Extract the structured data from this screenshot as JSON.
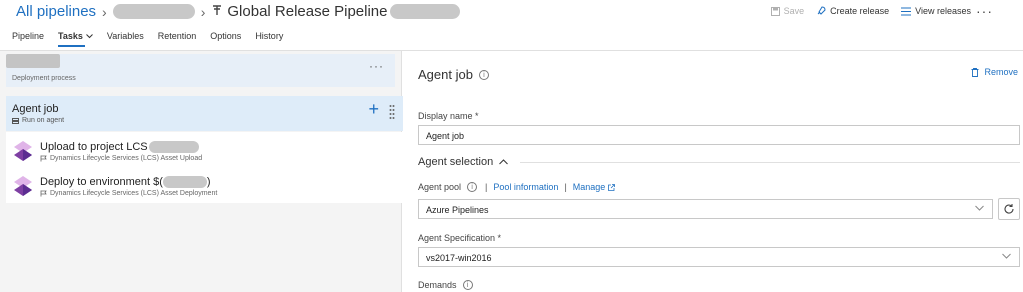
{
  "header": {
    "breadcrumb_root": "All pipelines",
    "pipeline_title": "Global Release Pipeline",
    "actions": {
      "save": "Save",
      "create_release": "Create release",
      "view_releases": "View releases",
      "more": "···"
    }
  },
  "tabs": [
    {
      "label": "Pipeline"
    },
    {
      "label": "Tasks"
    },
    {
      "label": "Variables"
    },
    {
      "label": "Retention"
    },
    {
      "label": "Options"
    },
    {
      "label": "History"
    }
  ],
  "left": {
    "stage": {
      "subtitle": "Deployment process",
      "more": "···"
    },
    "job": {
      "name": "Agent job",
      "subtitle": "Run on agent",
      "add": "+"
    },
    "tasks": [
      {
        "name": "Upload to project LCS",
        "subtitle": "Dynamics Lifecycle Services (LCS) Asset Upload"
      },
      {
        "name": "Deploy to environment $(",
        "name_suffix": ")",
        "subtitle": "Dynamics Lifecycle Services (LCS) Asset Deployment"
      }
    ]
  },
  "right": {
    "title": "Agent job",
    "remove": "Remove",
    "display_name_label": "Display name *",
    "display_name_value": "Agent job",
    "agent_selection": "Agent selection",
    "agent_pool_label": "Agent pool",
    "pool_information": "Pool information",
    "manage": "Manage",
    "agent_pool_value": "Azure Pipelines",
    "agent_spec_label": "Agent Specification *",
    "agent_spec_value": "vs2017-win2016",
    "demands_label": "Demands"
  },
  "colors": {
    "accent": "#1f70c1",
    "selected_bg": "#deecf9",
    "panel_bg": "#f4f4f4"
  }
}
